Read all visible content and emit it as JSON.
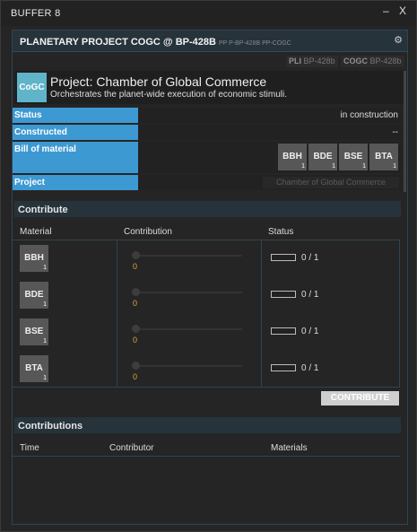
{
  "window": {
    "title": "BUFFER 8",
    "minimize": "–",
    "close": "X"
  },
  "panel": {
    "title": "PLANETARY PROJECT COGC @ BP-428B",
    "subtitle": "PP P-BP-428B PP-COGC",
    "tags": [
      {
        "key": "PLI",
        "value": "BP-428b"
      },
      {
        "key": "COGC",
        "value": "BP-428b"
      }
    ]
  },
  "project": {
    "logo": "CoGC",
    "logo_color": "#5fb4c9",
    "name": "Project: Chamber of Global Commerce",
    "description": "Orchestrates the planet-wide execution of economic stimuli."
  },
  "fields": {
    "status_label": "Status",
    "status_value": "in construction",
    "constructed_label": "Constructed",
    "constructed_value": "--",
    "bill_label": "Bill of material",
    "project_label": "Project",
    "project_value": "Chamber of Global Commerce"
  },
  "bill": [
    {
      "ticker": "BBH",
      "qty": "1"
    },
    {
      "ticker": "BDE",
      "qty": "1"
    },
    {
      "ticker": "BSE",
      "qty": "1"
    },
    {
      "ticker": "BTA",
      "qty": "1"
    }
  ],
  "contribute": {
    "section_title": "Contribute",
    "columns": {
      "material": "Material",
      "contribution": "Contribution",
      "status": "Status"
    },
    "rows": [
      {
        "ticker": "BBH",
        "qty": "1",
        "contribution": "0",
        "status": "0 / 1",
        "progress": 0
      },
      {
        "ticker": "BDE",
        "qty": "1",
        "contribution": "0",
        "status": "0 / 1",
        "progress": 0
      },
      {
        "ticker": "BSE",
        "qty": "1",
        "contribution": "0",
        "status": "0 / 1",
        "progress": 0
      },
      {
        "ticker": "BTA",
        "qty": "1",
        "contribution": "0",
        "status": "0 / 1",
        "progress": 0
      }
    ],
    "button": "CONTRIBUTE"
  },
  "contributions": {
    "section_title": "Contributions",
    "columns": {
      "time": "Time",
      "contributor": "Contributor",
      "materials": "Materials"
    }
  },
  "colors": {
    "label_blue": "#3d99d2",
    "header_teal": "#26333b",
    "accent_orange": "#e0a040"
  }
}
